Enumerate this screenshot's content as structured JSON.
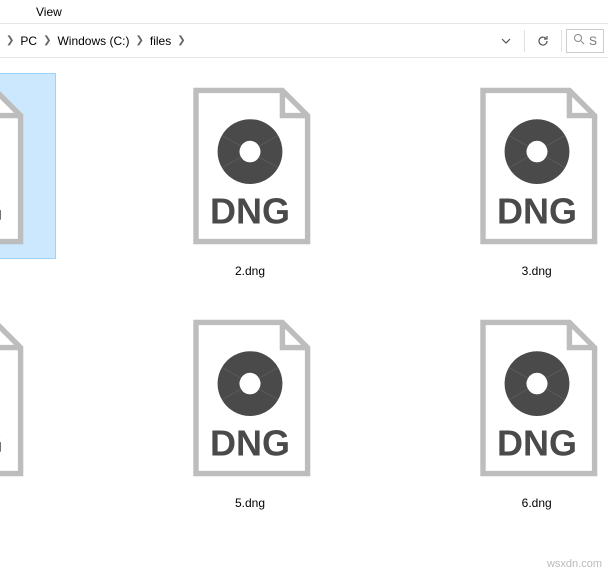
{
  "menu": {
    "view": "View"
  },
  "breadcrumb": {
    "pc": "PC",
    "drive": "Windows (C:)",
    "folder": "files"
  },
  "search": {
    "placeholder": "S"
  },
  "file_ext_label": "DNG",
  "files": [
    {
      "name": ""
    },
    {
      "name": "2.dng"
    },
    {
      "name": "3.dng"
    },
    {
      "name": ""
    },
    {
      "name": "5.dng"
    },
    {
      "name": "6.dng"
    }
  ],
  "watermark": "wsxdn.com"
}
